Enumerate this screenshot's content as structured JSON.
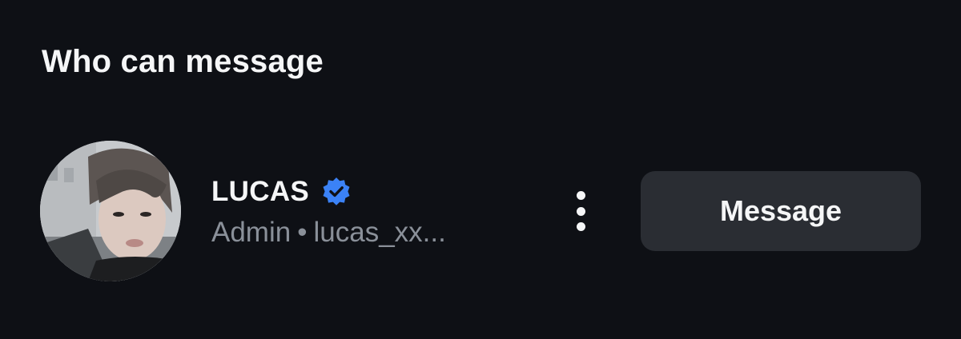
{
  "section": {
    "title": "Who can message"
  },
  "member": {
    "name": "LUCAS",
    "verified": true,
    "verified_icon": "verified-badge-icon",
    "role": "Admin",
    "separator": "•",
    "username": "lucas_xx..."
  },
  "actions": {
    "more_icon": "vertical-ellipsis-icon",
    "message_label": "Message"
  },
  "colors": {
    "background": "#0e1015",
    "primary_text": "#f5f6f7",
    "secondary_text": "#8a9099",
    "button_bg": "#2a2d33",
    "verified_blue": "#3b82f6"
  }
}
